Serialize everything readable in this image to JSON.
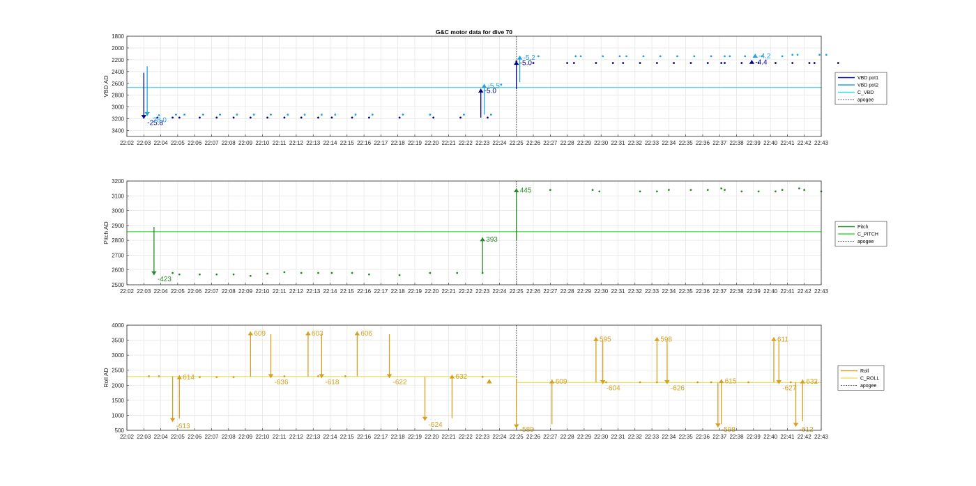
{
  "figure": {
    "title": "G&C motor data for dive 70"
  },
  "chart_data": [
    {
      "type": "line",
      "ylabel": "VBD AD",
      "ylim": [
        1800,
        3500
      ],
      "y_reversed": true,
      "yticks": [
        "1800",
        "2000",
        "2200",
        "2400",
        "2600",
        "2800",
        "3000",
        "3200",
        "3400"
      ],
      "xticks": [
        "22:02",
        "22:03",
        "22:04",
        "22:05",
        "22:06",
        "22:07",
        "22:08",
        "22:09",
        "22:10",
        "22:11",
        "22:12",
        "22:13",
        "22:14",
        "22:15",
        "22:16",
        "22:17",
        "22:18",
        "22:19",
        "22:20",
        "22:21",
        "22:22",
        "22:23",
        "22:24",
        "22:25",
        "22:26",
        "22:27",
        "22:28",
        "22:29",
        "22:30",
        "22:31",
        "22:32",
        "22:33",
        "22:34",
        "22:35",
        "22:36",
        "22:37",
        "22:38",
        "22:39",
        "22:40",
        "22:41",
        "22:42",
        "22:43"
      ],
      "grid": true,
      "legend_position": "right",
      "legend": [
        "VBD pot1",
        "VBD pot2",
        "C_VBD",
        "apogee"
      ],
      "colors": {
        "VBD pot1": "#00008b",
        "VBD pot2": "#1fa3e0",
        "C_VBD": "#33e0ea",
        "apogee": "#555555"
      },
      "reference_lines": [
        {
          "series": "C_VBD",
          "y": 2670
        }
      ],
      "apogee_x": 23.0,
      "series": [
        {
          "name": "VBD pot1",
          "points": [
            [
              1.8,
              3180
            ],
            [
              2.7,
              3180
            ],
            [
              3.1,
              3180
            ],
            [
              4.3,
              3180
            ],
            [
              5.3,
              3180
            ],
            [
              6.3,
              3180
            ],
            [
              7.3,
              3180
            ],
            [
              8.3,
              3180
            ],
            [
              9.3,
              3180
            ],
            [
              10.3,
              3180
            ],
            [
              11.3,
              3180
            ],
            [
              12.1,
              3180
            ],
            [
              13.3,
              3180
            ],
            [
              14.3,
              3180
            ],
            [
              16.1,
              3180
            ],
            [
              18.1,
              3180
            ],
            [
              19.7,
              3180
            ],
            [
              21.3,
              3180
            ],
            [
              23.0,
              2225
            ],
            [
              24.0,
              2255
            ],
            [
              26.0,
              2255
            ],
            [
              26.4,
              2255
            ],
            [
              27.7,
              2255
            ],
            [
              28.7,
              2255
            ],
            [
              29.3,
              2255
            ],
            [
              30.3,
              2255
            ],
            [
              31.3,
              2255
            ],
            [
              32.3,
              2255
            ],
            [
              33.3,
              2255
            ],
            [
              34.3,
              2255
            ],
            [
              35.1,
              2255
            ],
            [
              35.3,
              2255
            ],
            [
              36.3,
              2255
            ],
            [
              37.3,
              2255
            ],
            [
              38.3,
              2255
            ],
            [
              39.3,
              2255
            ],
            [
              40.3,
              2255
            ],
            [
              40.6,
              2255
            ],
            [
              42.0,
              2255
            ]
          ]
        },
        {
          "name": "VBD pot2",
          "points": [
            [
              1.9,
              3140
            ],
            [
              2.9,
              3130
            ],
            [
              3.4,
              3130
            ],
            [
              4.5,
              3130
            ],
            [
              5.5,
              3130
            ],
            [
              6.5,
              3130
            ],
            [
              7.5,
              3130
            ],
            [
              8.5,
              3130
            ],
            [
              9.5,
              3130
            ],
            [
              10.5,
              3130
            ],
            [
              11.5,
              3130
            ],
            [
              12.3,
              3130
            ],
            [
              13.5,
              3130
            ],
            [
              14.5,
              3130
            ],
            [
              16.3,
              3130
            ],
            [
              17.9,
              3130
            ],
            [
              19.9,
              3130
            ],
            [
              21.5,
              3130
            ],
            [
              22.1,
              2620
            ],
            [
              24.3,
              2140
            ],
            [
              26.5,
              2140
            ],
            [
              26.8,
              2140
            ],
            [
              28.1,
              2140
            ],
            [
              29.1,
              2140
            ],
            [
              29.5,
              2140
            ],
            [
              30.5,
              2140
            ],
            [
              31.5,
              2140
            ],
            [
              32.5,
              2140
            ],
            [
              33.5,
              2140
            ],
            [
              34.5,
              2140
            ],
            [
              35.3,
              2140
            ],
            [
              35.6,
              2140
            ],
            [
              36.5,
              2140
            ],
            [
              37.5,
              2140
            ],
            [
              38.7,
              2140
            ],
            [
              39.3,
              2115
            ],
            [
              39.6,
              2115
            ],
            [
              40.9,
              2115
            ],
            [
              41.3,
              2115
            ]
          ]
        }
      ],
      "arrows": [
        {
          "series": "VBD pot1",
          "x": 1.0,
          "from": 2420,
          "to": 3200,
          "label": "-25.8"
        },
        {
          "series": "VBD pot2",
          "x": 1.2,
          "from": 2310,
          "to": 3150,
          "label": "-28.0"
        },
        {
          "series": "VBD pot1",
          "x": 20.9,
          "from": 3180,
          "to": 2690,
          "label": "-5.0"
        },
        {
          "series": "VBD pot2",
          "x": 21.1,
          "from": 3130,
          "to": 2610,
          "label": "-5.5"
        },
        {
          "series": "VBD pot1",
          "x": 23.0,
          "from": 2700,
          "to": 2220,
          "label": "-5.0"
        },
        {
          "series": "VBD pot2",
          "x": 23.2,
          "from": 2580,
          "to": 2130,
          "label": "-5.2"
        },
        {
          "series": "VBD pot1",
          "x": 36.9,
          "from": 2230,
          "to": 2205,
          "label": "-4.4"
        },
        {
          "series": "VBD pot2",
          "x": 37.1,
          "from": 2120,
          "to": 2100,
          "label": "-4.2"
        }
      ]
    },
    {
      "type": "line",
      "ylabel": "Pitch AD",
      "ylim": [
        2500,
        3200
      ],
      "y_reversed": false,
      "yticks": [
        "2500",
        "2600",
        "2700",
        "2800",
        "2900",
        "3000",
        "3100",
        "3200"
      ],
      "xticks": [
        "22:02",
        "22:03",
        "22:04",
        "22:05",
        "22:06",
        "22:07",
        "22:08",
        "22:09",
        "22:10",
        "22:11",
        "22:12",
        "22:13",
        "22:14",
        "22:15",
        "22:16",
        "22:17",
        "22:18",
        "22:19",
        "22:20",
        "22:21",
        "22:22",
        "22:23",
        "22:24",
        "22:25",
        "22:26",
        "22:27",
        "22:28",
        "22:29",
        "22:30",
        "22:31",
        "22:32",
        "22:33",
        "22:34",
        "22:35",
        "22:36",
        "22:37",
        "22:38",
        "22:39",
        "22:40",
        "22:41",
        "22:42",
        "22:43"
      ],
      "grid": true,
      "legend_position": "right",
      "legend": [
        "Pitch",
        "C_PITCH",
        "apogee"
      ],
      "colors": {
        "Pitch": "#2a8a2a",
        "C_PITCH": "#33dd33",
        "apogee": "#555555"
      },
      "reference_lines": [
        {
          "series": "C_PITCH",
          "y": 2858
        }
      ],
      "apogee_x": 23.0,
      "series": [
        {
          "name": "Pitch",
          "points": [
            [
              2.7,
              2580
            ],
            [
              3.1,
              2570
            ],
            [
              4.3,
              2570
            ],
            [
              5.3,
              2570
            ],
            [
              6.3,
              2570
            ],
            [
              7.3,
              2560
            ],
            [
              8.3,
              2575
            ],
            [
              9.3,
              2585
            ],
            [
              10.3,
              2580
            ],
            [
              11.3,
              2580
            ],
            [
              12.1,
              2580
            ],
            [
              13.3,
              2580
            ],
            [
              14.3,
              2570
            ],
            [
              16.1,
              2565
            ],
            [
              17.9,
              2580
            ],
            [
              19.5,
              2580
            ],
            [
              21.0,
              2580
            ],
            [
              25.0,
              3140
            ],
            [
              27.5,
              3140
            ],
            [
              27.9,
              3130
            ],
            [
              30.3,
              3130
            ],
            [
              31.3,
              3130
            ],
            [
              32.0,
              3140
            ],
            [
              33.3,
              3140
            ],
            [
              34.3,
              3140
            ],
            [
              35.1,
              3150
            ],
            [
              35.3,
              3140
            ],
            [
              36.3,
              3130
            ],
            [
              37.3,
              3130
            ],
            [
              38.3,
              3130
            ],
            [
              38.7,
              3140
            ],
            [
              39.7,
              3150
            ],
            [
              40.0,
              3140
            ],
            [
              41.0,
              3130
            ]
          ]
        }
      ],
      "arrows": [
        {
          "series": "Pitch",
          "x": 1.6,
          "from": 2890,
          "to": 2565,
          "label": "-423"
        },
        {
          "series": "Pitch",
          "x": 21.0,
          "from": 2580,
          "to": 2820,
          "label": "393"
        },
        {
          "series": "Pitch",
          "x": 23.0,
          "from": 2800,
          "to": 3150,
          "label": "445"
        }
      ]
    },
    {
      "type": "line",
      "ylabel": "Roll AD",
      "ylim": [
        500,
        4000
      ],
      "y_reversed": false,
      "yticks": [
        "500",
        "1000",
        "1500",
        "2000",
        "2500",
        "3000",
        "3500",
        "4000"
      ],
      "xticks": [
        "22:02",
        "22:03",
        "22:04",
        "22:05",
        "22:06",
        "22:07",
        "22:08",
        "22:09",
        "22:10",
        "22:11",
        "22:12",
        "22:13",
        "22:14",
        "22:15",
        "22:16",
        "22:17",
        "22:18",
        "22:19",
        "22:20",
        "22:21",
        "22:22",
        "22:23",
        "22:24",
        "22:25",
        "22:26",
        "22:27",
        "22:28",
        "22:29",
        "22:30",
        "22:31",
        "22:32",
        "22:33",
        "22:34",
        "22:35",
        "22:36",
        "22:37",
        "22:38",
        "22:39",
        "22:40",
        "22:41",
        "22:42",
        "22:43"
      ],
      "grid": true,
      "legend_position": "right",
      "legend": [
        "Roll",
        "C_ROLL",
        "apogee"
      ],
      "colors": {
        "Roll": "#d4a020",
        "C_ROLL": "#f0e060",
        "apogee": "#555555"
      },
      "reference_lines": [
        {
          "series": "C_ROLL",
          "y": 2290,
          "x_range": [
            0,
            23.0
          ]
        },
        {
          "series": "C_ROLL",
          "y": 2090,
          "x_range": [
            23.0,
            41.0
          ]
        }
      ],
      "apogee_x": 23.0,
      "series": [
        {
          "name": "Roll",
          "points": [
            [
              1.3,
              2300
            ],
            [
              1.9,
              2300
            ],
            [
              4.3,
              2270
            ],
            [
              5.3,
              2270
            ],
            [
              6.3,
              2270
            ],
            [
              9.3,
              2300
            ],
            [
              11.3,
              2300
            ],
            [
              12.9,
              2300
            ],
            [
              21.0,
              2280
            ],
            [
              28.3,
              2100
            ],
            [
              30.3,
              2100
            ],
            [
              31.3,
              2100
            ],
            [
              33.7,
              2100
            ],
            [
              34.5,
              2100
            ],
            [
              36.7,
              2100
            ],
            [
              39.2,
              2100
            ],
            [
              40.7,
              2100
            ]
          ]
        }
      ],
      "markers": [
        {
          "series": "Roll",
          "x": 21.4,
          "y": 2120
        }
      ],
      "arrows": [
        {
          "series": "Roll",
          "x": 2.7,
          "from": 2290,
          "to": 780,
          "label": "-613"
        },
        {
          "series": "Roll",
          "x": 3.1,
          "from": 900,
          "to": 2330,
          "label": "614"
        },
        {
          "series": "Roll",
          "x": 7.3,
          "from": 2290,
          "to": 3790,
          "label": "609"
        },
        {
          "series": "Roll",
          "x": 8.5,
          "from": 3700,
          "to": 2240,
          "label": "-636"
        },
        {
          "series": "Roll",
          "x": 10.7,
          "from": 2290,
          "to": 3790,
          "label": "603"
        },
        {
          "series": "Roll",
          "x": 11.5,
          "from": 3700,
          "to": 2240,
          "label": "-618"
        },
        {
          "series": "Roll",
          "x": 13.6,
          "from": 2300,
          "to": 3790,
          "label": "606"
        },
        {
          "series": "Roll",
          "x": 15.5,
          "from": 3700,
          "to": 2240,
          "label": "-622"
        },
        {
          "series": "Roll",
          "x": 17.6,
          "from": 2280,
          "to": 820,
          "label": "-624"
        },
        {
          "series": "Roll",
          "x": 19.2,
          "from": 900,
          "to": 2350,
          "label": "632"
        },
        {
          "series": "Roll",
          "x": 23.0,
          "from": 2200,
          "to": 570,
          "label": "-589"
        },
        {
          "series": "Roll",
          "x": 25.1,
          "from": 700,
          "to": 2190,
          "label": "609"
        },
        {
          "series": "Roll",
          "x": 27.7,
          "from": 2100,
          "to": 3600,
          "label": "595"
        },
        {
          "series": "Roll",
          "x": 28.1,
          "from": 3500,
          "to": 2040,
          "label": "-604"
        },
        {
          "series": "Roll",
          "x": 31.3,
          "from": 2100,
          "to": 3600,
          "label": "598"
        },
        {
          "series": "Roll",
          "x": 31.9,
          "from": 3500,
          "to": 2040,
          "label": "-626"
        },
        {
          "series": "Roll",
          "x": 34.9,
          "from": 2080,
          "to": 600,
          "label": "-598"
        },
        {
          "series": "Roll",
          "x": 35.1,
          "from": 700,
          "to": 2200,
          "label": "615"
        },
        {
          "series": "Roll",
          "x": 38.2,
          "from": 2100,
          "to": 3600,
          "label": "611"
        },
        {
          "series": "Roll",
          "x": 38.5,
          "from": 3500,
          "to": 2040,
          "label": "-627"
        },
        {
          "series": "Roll",
          "x": 39.5,
          "from": 2100,
          "to": 620,
          "label": "-612"
        },
        {
          "series": "Roll",
          "x": 39.9,
          "from": 800,
          "to": 2190,
          "label": "632"
        }
      ]
    }
  ]
}
